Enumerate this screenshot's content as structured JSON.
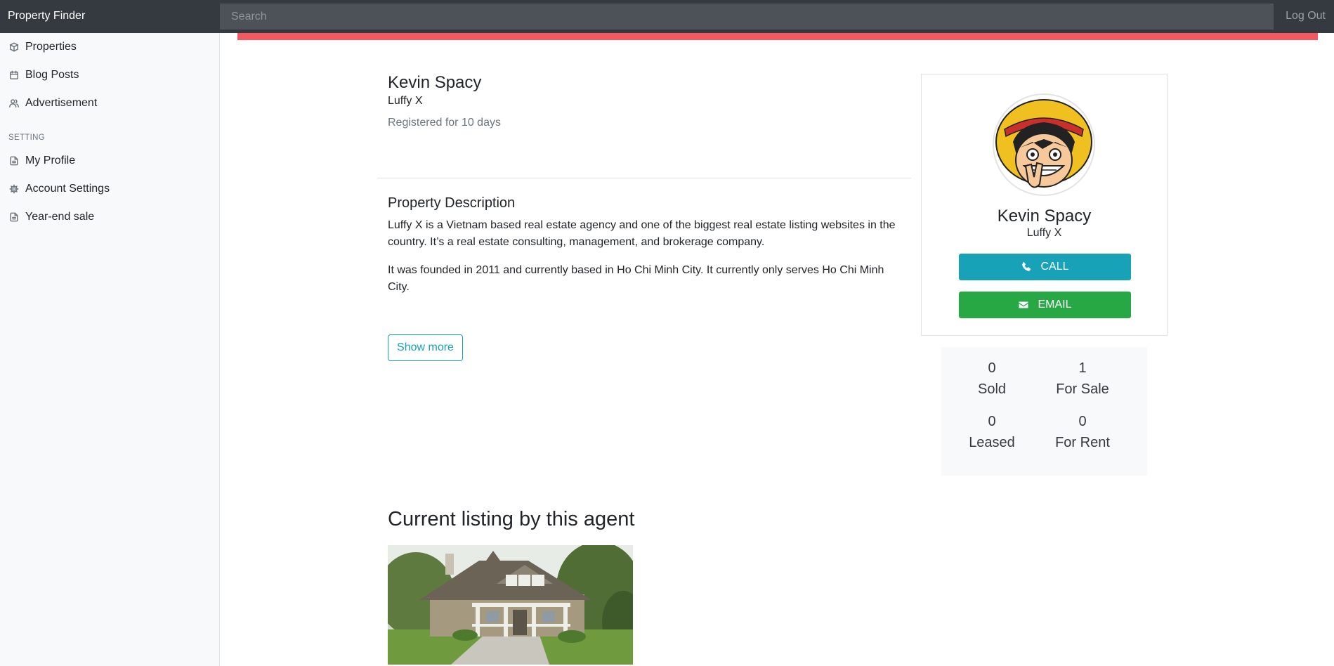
{
  "navbar": {
    "brand": "Property Finder",
    "search_placeholder": "Search",
    "logout": "Log Out"
  },
  "sidebar": {
    "items": [
      {
        "label": "Properties",
        "icon": "box-icon"
      },
      {
        "label": "Blog Posts",
        "icon": "calendar-icon"
      },
      {
        "label": "Advertisement",
        "icon": "users-icon"
      }
    ],
    "setting_heading": "SETTING",
    "setting_items": [
      {
        "label": "My Profile",
        "icon": "file-icon"
      },
      {
        "label": "Account Settings",
        "icon": "gear-icon"
      },
      {
        "label": "Year-end sale",
        "icon": "file-icon"
      }
    ]
  },
  "alert_color": "#f35a5f",
  "agent": {
    "name": "Kevin Spacy",
    "agency": "Luffy X",
    "registered": "Registered for 10 days"
  },
  "description": {
    "title": "Property Description",
    "paragraphs": [
      "Luffy X is a Vietnam based real estate agency and one of the biggest real estate listing websites in the country. It’s a real estate consulting, management, and brokerage company.",
      "It was founded in 2011 and currently based in Ho Chi Minh City. It currently only serves Ho Chi Minh City."
    ],
    "show_more": "Show more"
  },
  "card": {
    "name": "Kevin Spacy",
    "agency": "Luffy X",
    "call_label": "CALL",
    "email_label": "EMAIL",
    "call_color": "#17a2b8",
    "email_color": "#28a745"
  },
  "stats": {
    "sold": {
      "value": "0",
      "label": "Sold"
    },
    "for_sale": {
      "value": "1",
      "label": "For Sale"
    },
    "leased": {
      "value": "0",
      "label": "Leased"
    },
    "for_rent": {
      "value": "0",
      "label": "For Rent"
    }
  },
  "listing": {
    "title": "Current listing by this agent"
  }
}
